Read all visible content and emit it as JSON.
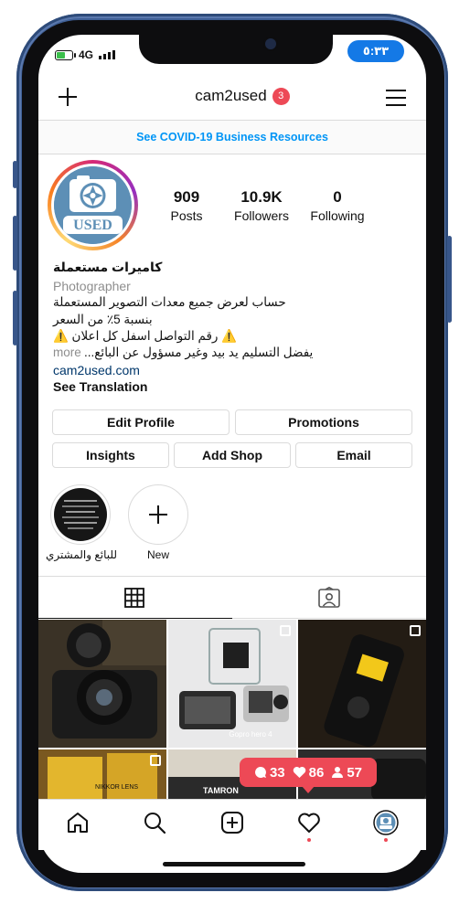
{
  "status": {
    "network": "4G",
    "time": "٥:٣٣"
  },
  "header": {
    "username": "cam2used",
    "notification_count": "3"
  },
  "banner": {
    "text": "See COVID-19 Business Resources"
  },
  "stats": [
    {
      "value": "909",
      "label": "Posts"
    },
    {
      "value": "10.9K",
      "label": "Followers"
    },
    {
      "value": "0",
      "label": "Following"
    }
  ],
  "avatar": {
    "text": "USED"
  },
  "bio": {
    "name": "كاميرات مستعملة",
    "category": "Photographer",
    "lines": [
      "حساب لعرض جميع معدات التصوير المستعملة",
      "بنسبة 5٪ من السعر",
      "⚠️ رقم التواصل اسفل كل اعلان ⚠️",
      "يفضل التسليم يد بيد وغير مسؤول عن البائع..."
    ],
    "more": "more",
    "link": "cam2used.com",
    "see_translation": "See Translation"
  },
  "buttons": {
    "edit_profile": "Edit Profile",
    "promotions": "Promotions",
    "insights": "Insights",
    "add_shop": "Add Shop",
    "email": "Email"
  },
  "highlights": [
    {
      "label": "للبائع والمشتري"
    },
    {
      "label": "New"
    }
  ],
  "grid_posts": [
    {
      "caption": ""
    },
    {
      "caption": "Gopro hero 4"
    },
    {
      "caption": ""
    },
    {
      "caption": "NIKKOR LENS"
    },
    {
      "caption": "TAMRON"
    },
    {
      "caption": ""
    }
  ],
  "activity": {
    "comments": "33",
    "likes": "86",
    "followers": "57"
  },
  "colors": {
    "accent": "#0095f6",
    "badge": "#ed4956",
    "frame": "#3f5f95",
    "time_pill": "#1479e6"
  }
}
